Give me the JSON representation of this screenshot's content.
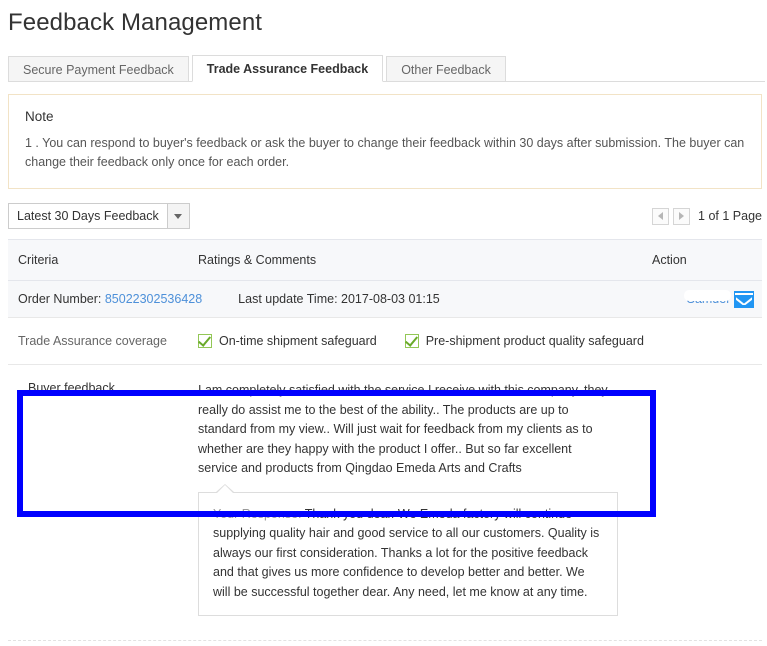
{
  "page": {
    "title": "Feedback Management"
  },
  "tabs": [
    {
      "label": "Secure Payment Feedback",
      "active": false
    },
    {
      "label": "Trade Assurance Feedback",
      "active": true
    },
    {
      "label": "Other Feedback",
      "active": false
    }
  ],
  "note": {
    "title": "Note",
    "text": "1 . You can respond to buyer's feedback or ask the buyer to change their feedback within 30 days after submission. The buyer can change their feedback only once for each order."
  },
  "filter": {
    "selected": "Latest 30 Days Feedback",
    "dropdown_icon": "chevron-down-icon"
  },
  "pagination": {
    "prev_icon": "triangle-left-icon",
    "next_icon": "triangle-right-icon",
    "label": "1 of 1 Page"
  },
  "table": {
    "headers": {
      "criteria": "Criteria",
      "ratings": "Ratings & Comments",
      "action": "Action"
    },
    "order": {
      "order_number_label": "Order Number:",
      "order_number": "85022302536428",
      "last_update_label": "Last update Time:",
      "last_update_time": "2017-08-03 01:15",
      "contact_name": "Samuel",
      "mail_icon": "envelope-icon"
    },
    "coverage": {
      "label": "Trade Assurance coverage",
      "items": [
        {
          "checked": true,
          "label": "On-time shipment safeguard"
        },
        {
          "checked": true,
          "label": "Pre-shipment product quality safeguard"
        }
      ]
    },
    "feedback": {
      "label": "Buyer feedback",
      "text": "I am completely satisfied with the service I receive with this company, they really do assist me to the best of the ability.. The products are up to standard from my view.. Will just wait for feedback from my clients as to whether are they happy with the product I offer.. But so far excellent service and products from Qingdao Emeda Arts and Crafts",
      "response_label": "Your Response:",
      "response_text": "Thank you dear. We Emeda factory will continue supplying quality hair and good service to all our customers. Quality is always our first consideration. Thanks a lot for the positive feedback and that gives us more confidence to develop better and better. We will be successful together dear. Any need, let me know at any time."
    }
  },
  "annotation": {
    "color": "#0000ff"
  }
}
